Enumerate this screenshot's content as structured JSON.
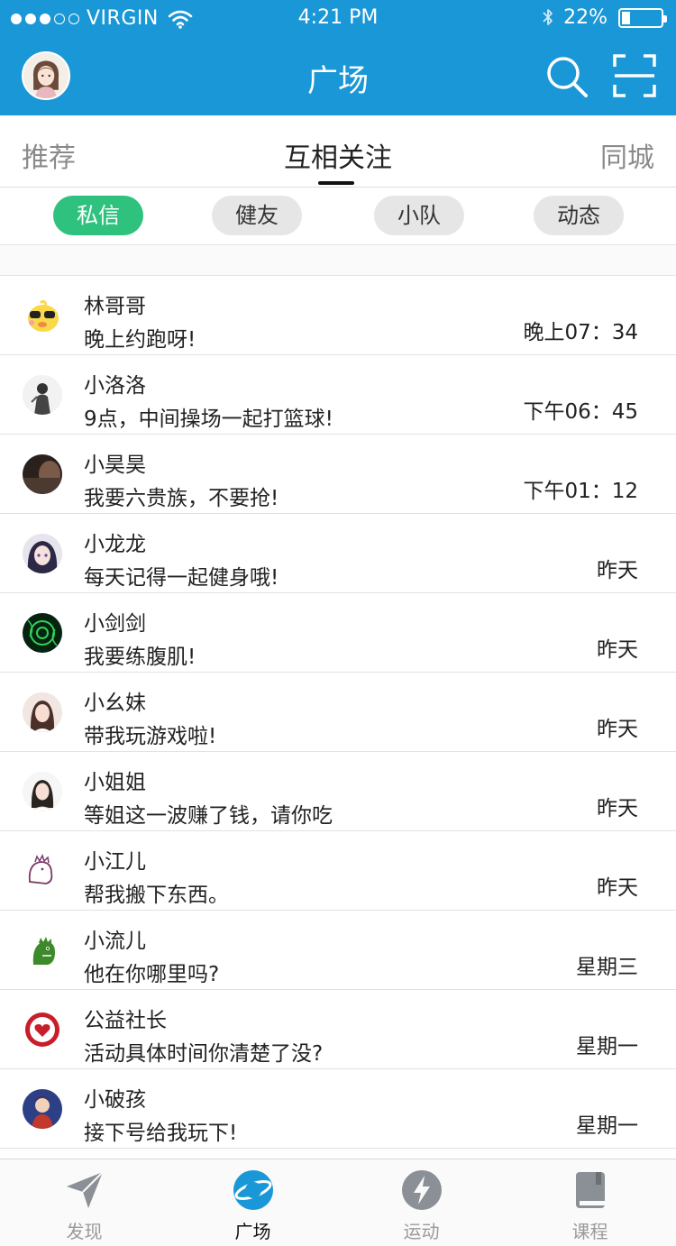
{
  "status_bar": {
    "carrier": "VIRGIN",
    "time": "4:21 PM",
    "battery_text": "22%",
    "battery_level": 0.22,
    "signal_bars_filled": 3,
    "signal_bars_total": 5
  },
  "header": {
    "title": "广场",
    "background_color": "#1a97d6"
  },
  "tabs": {
    "left": "推荐",
    "center": "互相关注",
    "right": "同城",
    "active": "互相关注"
  },
  "chips": [
    {
      "label": "私信",
      "active": true
    },
    {
      "label": "健友",
      "active": false
    },
    {
      "label": "小队",
      "active": false
    },
    {
      "label": "动态",
      "active": false
    }
  ],
  "chip_active_color": "#2ec27e",
  "messages": [
    {
      "name": "林哥哥",
      "text": "晚上约跑呀!",
      "time": "晚上07：34",
      "avatar_icon": "yellow-chick-avatar"
    },
    {
      "name": "小洛洛",
      "text": "9点，中间操场一起打篮球!",
      "time": "下午06：45",
      "avatar_icon": "sketch-portrait-avatar"
    },
    {
      "name": "小昊昊",
      "text": "我要六贵族，不要抢!",
      "time": "下午01：12",
      "avatar_icon": "dark-photo-avatar"
    },
    {
      "name": "小龙龙",
      "text": "每天记得一起健身哦!",
      "time": "昨天",
      "avatar_icon": "anime-girl-avatar"
    },
    {
      "name": "小剑剑",
      "text": "我要练腹肌!",
      "time": "昨天",
      "avatar_icon": "green-swirl-avatar"
    },
    {
      "name": "小幺妹",
      "text": "带我玩游戏啦!",
      "time": "昨天",
      "avatar_icon": "girl-photo-avatar"
    },
    {
      "name": "小姐姐",
      "text": "等姐这一波赚了钱，请你吃",
      "time": "昨天",
      "avatar_icon": "woman-photo-avatar"
    },
    {
      "name": "小江儿",
      "text": "帮我搬下东西。",
      "time": "昨天",
      "avatar_icon": "doodle-dinosaur-avatar"
    },
    {
      "name": "小流儿",
      "text": "他在你哪里吗?",
      "time": "星期三",
      "avatar_icon": "green-dinosaur-avatar"
    },
    {
      "name": "公益社长",
      "text": "活动具体时间你清楚了没?",
      "time": "星期一",
      "avatar_icon": "i-love-you-badge-avatar"
    },
    {
      "name": "小破孩",
      "text": "接下号给我玩下!",
      "time": "星期一",
      "avatar_icon": "game-character-avatar"
    }
  ],
  "bottom_tabs": [
    {
      "label": "发现",
      "icon": "paper-plane-icon",
      "active": false
    },
    {
      "label": "广场",
      "icon": "planet-icon",
      "active": true
    },
    {
      "label": "运动",
      "icon": "lightning-icon",
      "active": false
    },
    {
      "label": "课程",
      "icon": "book-icon",
      "active": false
    }
  ],
  "colors": {
    "brand_blue": "#1a97d6",
    "active_green": "#2ec27e",
    "inactive_icon_gray": "#9a9a9a"
  }
}
